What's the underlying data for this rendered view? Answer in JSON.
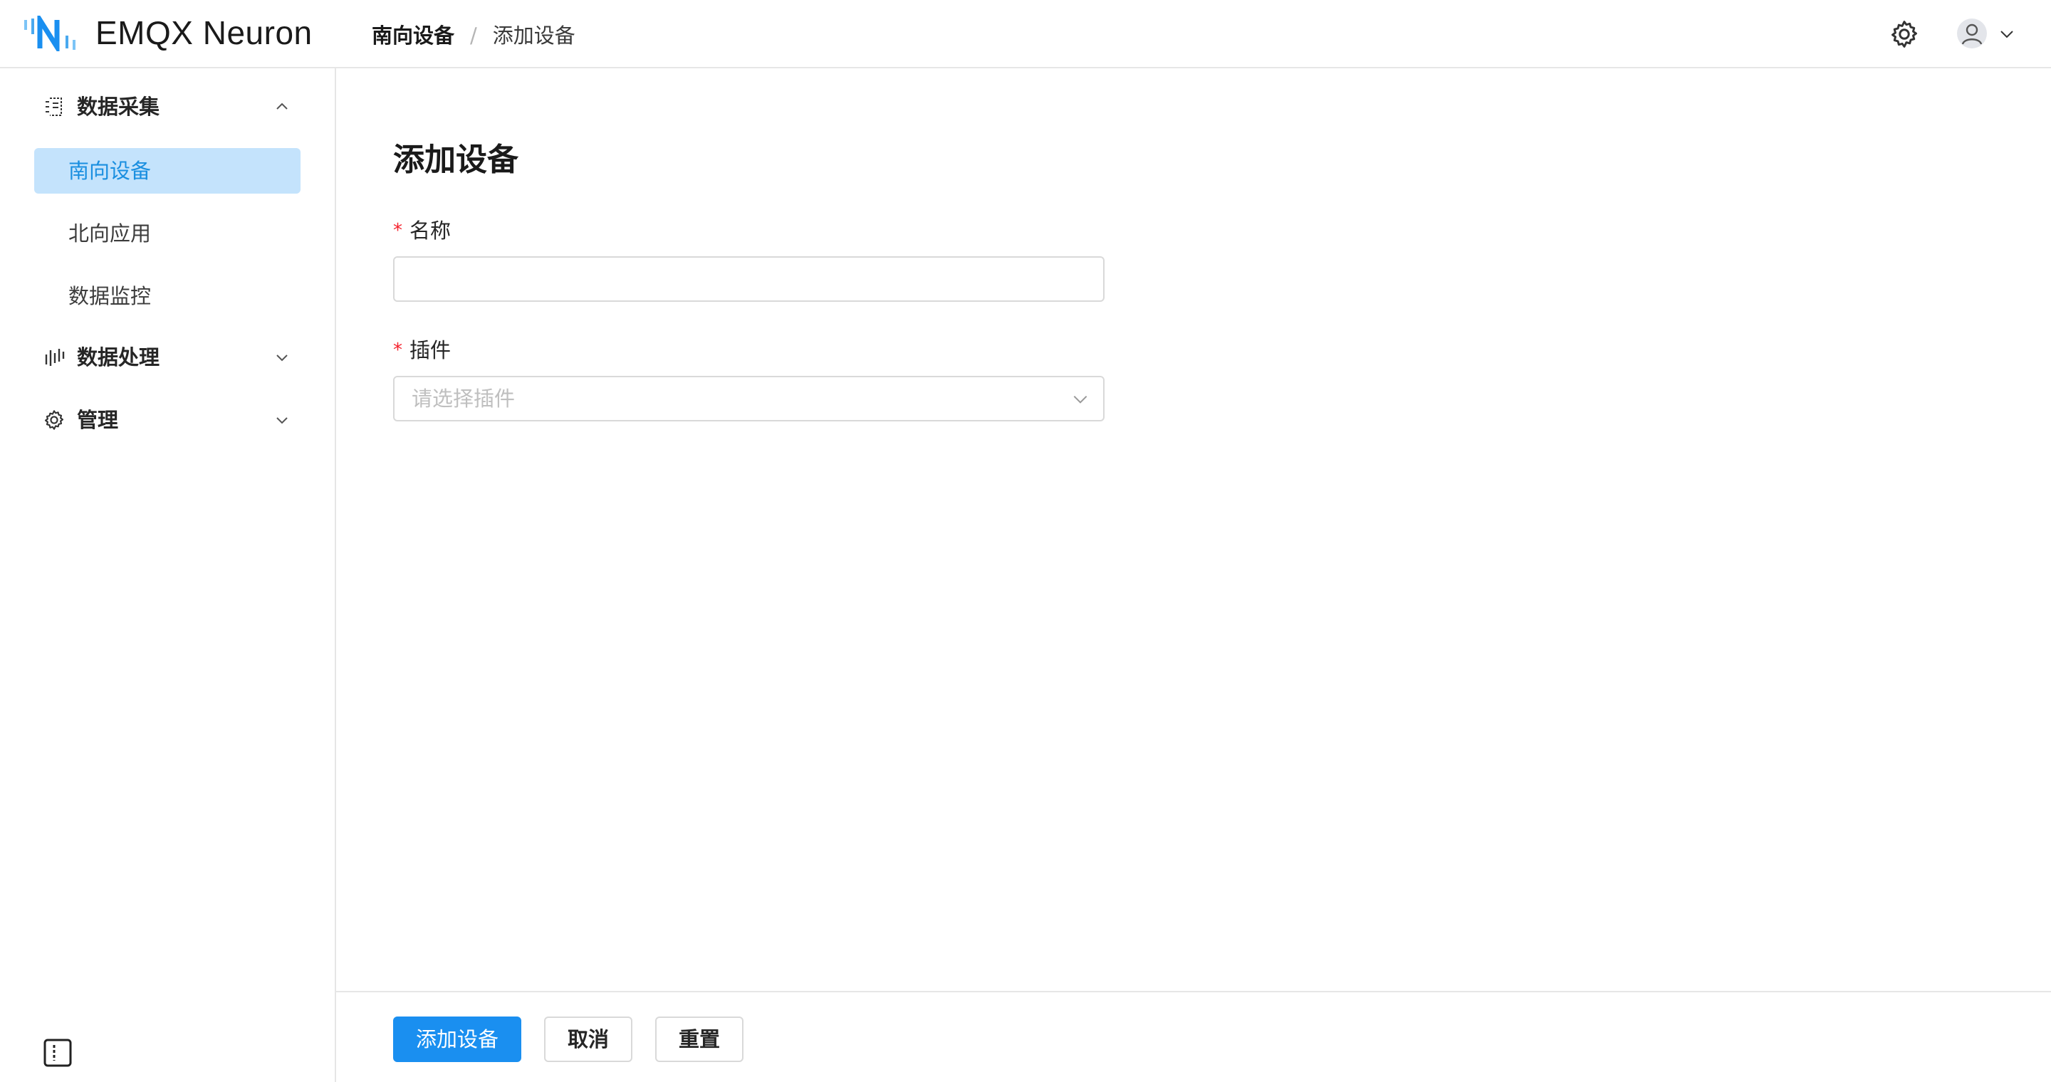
{
  "header": {
    "brand": "EMQX Neuron",
    "breadcrumb": [
      "南向设备",
      "添加设备"
    ],
    "breadcrumb_separator": "/",
    "accent_color": "#1a8ff0"
  },
  "sidebar": {
    "groups": [
      {
        "label": "数据采集",
        "icon": "data-collection-icon",
        "expanded": true,
        "items": [
          {
            "label": "南向设备",
            "active": true
          },
          {
            "label": "北向应用",
            "active": false
          },
          {
            "label": "数据监控",
            "active": false
          }
        ]
      },
      {
        "label": "数据处理",
        "icon": "data-processing-icon",
        "expanded": false
      },
      {
        "label": "管理",
        "icon": "gear-icon",
        "expanded": false
      }
    ]
  },
  "main": {
    "title": "添加设备",
    "form": {
      "name": {
        "label": "名称",
        "required": true,
        "value": ""
      },
      "plugin": {
        "label": "插件",
        "required": true,
        "placeholder": "请选择插件",
        "value": ""
      }
    },
    "required_mark": "*"
  },
  "footer": {
    "submit": "添加设备",
    "cancel": "取消",
    "reset": "重置"
  }
}
